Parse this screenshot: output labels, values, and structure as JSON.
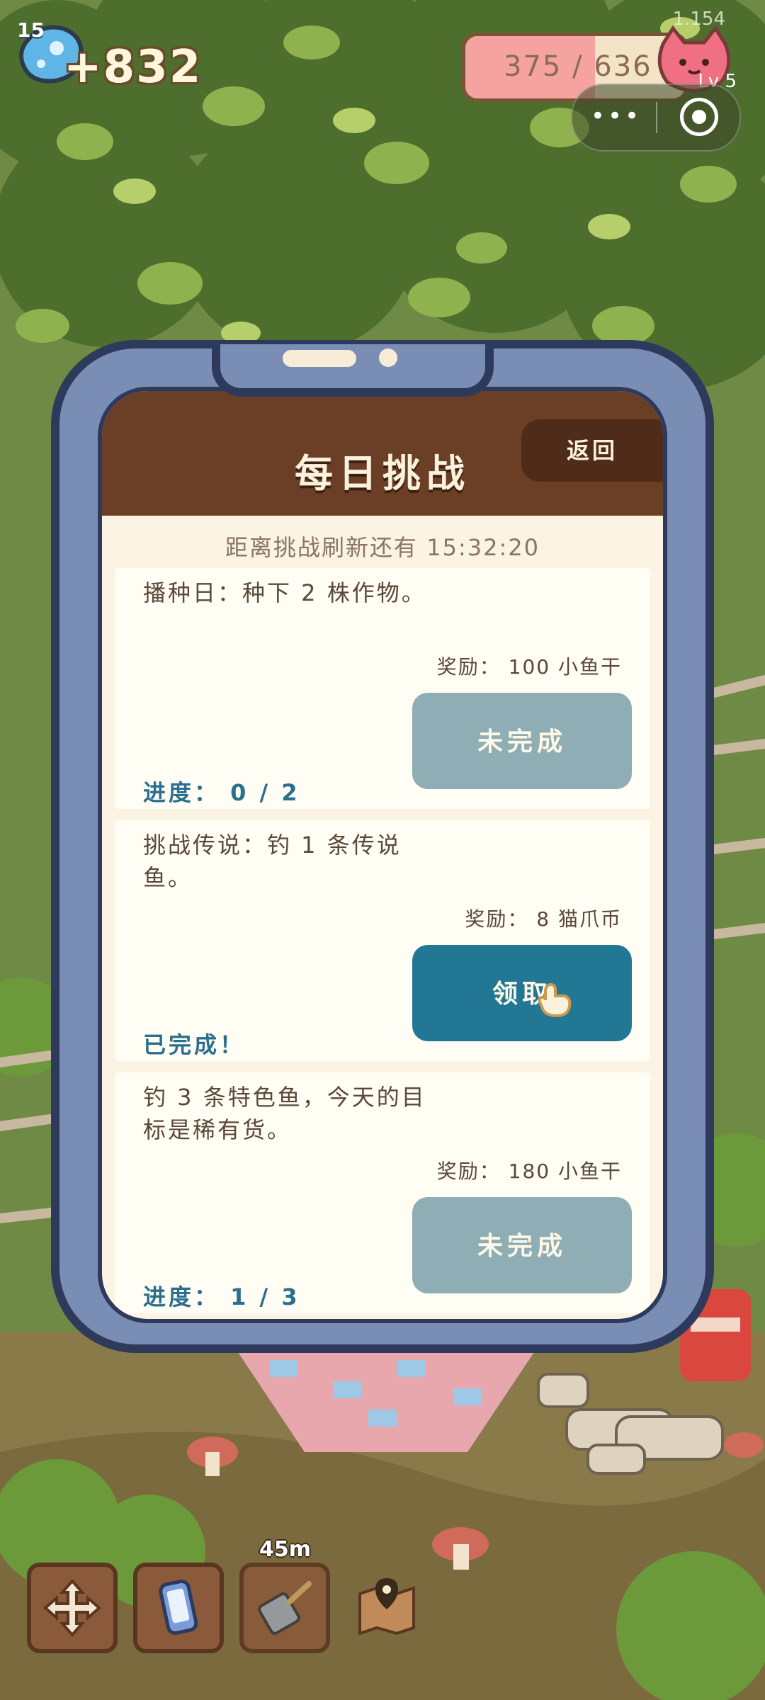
{
  "hud": {
    "version": "1.154",
    "gem_level": "15",
    "gem_amount": "+832",
    "xp_text": "375 / 636",
    "xp_fraction": 0.59,
    "cat_level": "Lv 5"
  },
  "mini_program": {
    "more_label": "•••"
  },
  "challenge": {
    "title": "每日挑战",
    "back_label": "返回",
    "refresh_text": "距离挑战刷新还有 15:32:20",
    "tasks": [
      {
        "desc": "播种日：种下 2 株作物。",
        "reward": "奖励： 100 小鱼干",
        "button": "未完成",
        "status": "进度： 0 / 2"
      },
      {
        "desc": "挑战传说：钓 1 条传说鱼。",
        "reward": "奖励： 8 猫爪币",
        "button": "领取",
        "status": "已完成！"
      },
      {
        "desc": "钓 3 条特色鱼，今天的目标是稀有货。",
        "reward": "奖励： 180 小鱼干",
        "button": "未完成",
        "status": "进度： 1 / 3"
      }
    ]
  },
  "toolbar": {
    "timer": "45m"
  }
}
